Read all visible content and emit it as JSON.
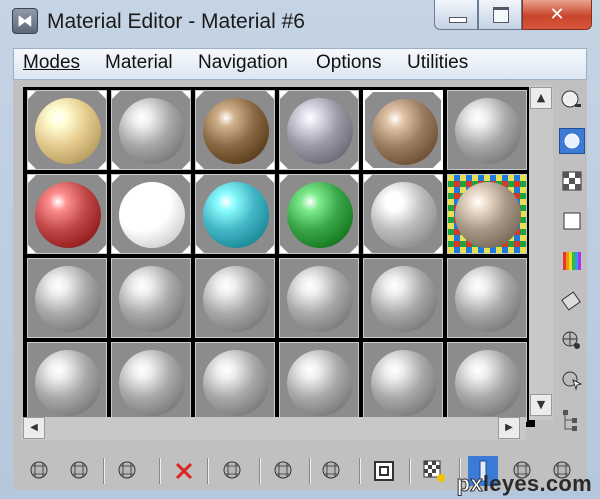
{
  "window": {
    "title": "Material Editor - Material #6",
    "app_icon": "3ds-max-logo-icon",
    "controls": [
      "minimize-icon",
      "maximize-icon",
      "close-icon"
    ],
    "close_glyph": "✕"
  },
  "menu": {
    "items": [
      {
        "label": "Modes"
      },
      {
        "label": "Material"
      },
      {
        "label": "Navigation"
      },
      {
        "label": "Options"
      },
      {
        "label": "Utilities"
      }
    ]
  },
  "slots": {
    "rows": [
      [
        {
          "name": "cream",
          "color": "#e6cb8f"
        },
        {
          "name": "speckled-grey",
          "color": "#a8a8a8"
        },
        {
          "name": "brown-granite",
          "color": "#8a6b45"
        },
        {
          "name": "glossy-grey-blue",
          "color": "#9a9aa6"
        },
        {
          "name": "brown-marble",
          "color": "#9b7d62",
          "active": true
        },
        {
          "name": "default-grey",
          "color": "#a9a9a9"
        }
      ],
      [
        {
          "name": "red",
          "color": "#c04848"
        },
        {
          "name": "white",
          "color": "#ffffff"
        },
        {
          "name": "cyan",
          "color": "#44b7c6"
        },
        {
          "name": "green",
          "color": "#3aa64a"
        },
        {
          "name": "chrome",
          "color": "#bdbdbd"
        },
        {
          "name": "map-stone",
          "color": "#a89888",
          "checker": true
        }
      ],
      [
        {
          "name": "default-grey",
          "color": "#a9a9a9"
        },
        {
          "name": "default-grey",
          "color": "#a9a9a9"
        },
        {
          "name": "default-grey",
          "color": "#a9a9a9"
        },
        {
          "name": "default-grey",
          "color": "#a9a9a9"
        },
        {
          "name": "default-grey",
          "color": "#a9a9a9"
        },
        {
          "name": "default-grey",
          "color": "#a9a9a9"
        }
      ],
      [
        {
          "name": "default-grey",
          "color": "#a9a9a9"
        },
        {
          "name": "default-grey",
          "color": "#a9a9a9"
        },
        {
          "name": "default-grey",
          "color": "#a9a9a9"
        },
        {
          "name": "default-grey",
          "color": "#a9a9a9"
        },
        {
          "name": "default-grey",
          "color": "#a9a9a9"
        },
        {
          "name": "default-grey",
          "color": "#a9a9a9"
        }
      ]
    ]
  },
  "scrollbars": {
    "up_arrow": "▲",
    "down_arrow": "▼",
    "left_arrow": "◀",
    "right_arrow": "▶"
  },
  "side_tools": [
    {
      "icon": "sample-type-sphere-icon"
    },
    {
      "icon": "backlight-icon",
      "selected": true
    },
    {
      "icon": "background-checker-icon"
    },
    {
      "icon": "sample-uv-tiling-icon"
    },
    {
      "icon": "video-color-check-icon"
    },
    {
      "icon": "make-preview-icon"
    },
    {
      "icon": "options-icon"
    },
    {
      "icon": "select-by-material-icon"
    },
    {
      "icon": "material-map-navigator-icon"
    }
  ],
  "bottom_tools": [
    {
      "icon": "get-material-icon"
    },
    {
      "icon": "put-material-to-scene-icon"
    },
    {
      "icon": "assign-material-to-selection-icon"
    },
    {
      "icon": "reset-map-icon"
    },
    {
      "icon": "copy-material-icon"
    },
    {
      "icon": "make-unique-icon"
    },
    {
      "icon": "put-to-library-icon"
    },
    {
      "icon": "material-id-channel-icon"
    },
    {
      "icon": "show-map-in-viewport-icon"
    },
    {
      "icon": "show-end-result-icon"
    },
    {
      "icon": "go-to-parent-icon"
    },
    {
      "icon": "go-forward-to-sibling-icon"
    }
  ],
  "colors": {
    "accent_selected": "#3b7bd5",
    "close_button": "#c9462c",
    "panel_bg": "#c0c0c0"
  },
  "watermark": {
    "prefix": "px",
    "rest": "leyes.com"
  }
}
